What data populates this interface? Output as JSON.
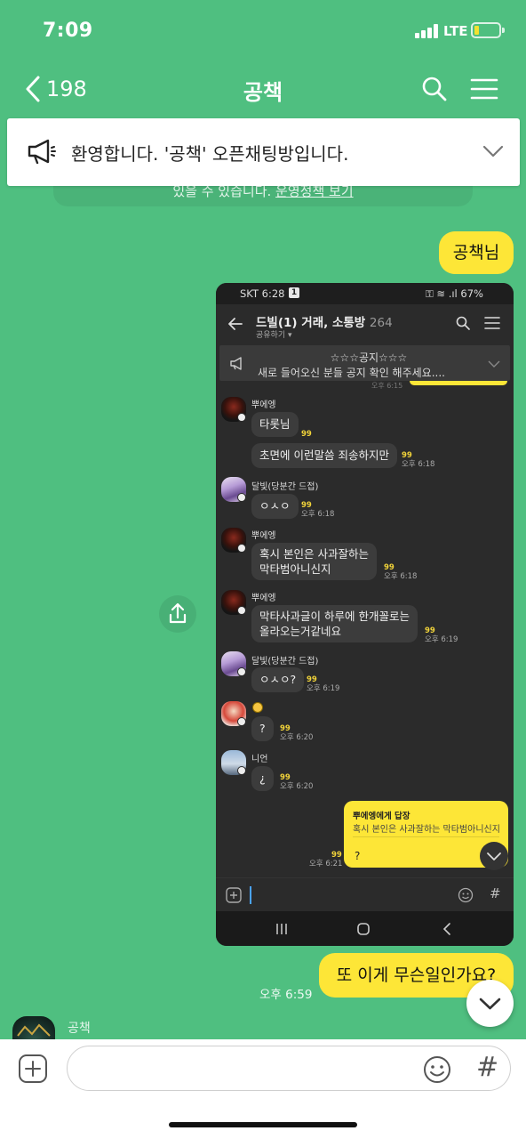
{
  "status_bar": {
    "time": "7:09",
    "network": "LTE"
  },
  "header": {
    "back_count": "198",
    "title": "공책"
  },
  "notice": {
    "text": "환영합니다. '공책' 오픈채팅방입니다.",
    "behind_text": "있을 수 있습니다. ",
    "behind_link": "운영정책 보기"
  },
  "messages": {
    "my_first": "공책님",
    "my_last": "또 이게 무슨일인가요?",
    "my_last_time": "오후 6:59"
  },
  "embedded_screenshot": {
    "status": {
      "carrier_time": "SKT 6:28",
      "badge": "1",
      "battery": "67%"
    },
    "title": "드빌(1) 거래, 소통방",
    "member_count": "264",
    "subtitle": "공유하기 ▾",
    "notice_title": "☆☆☆공지☆☆☆",
    "notice_text": "새로 들어오신 분들 공지 확인 해주세요....",
    "ghost_time": "오후 6:15",
    "messages": [
      {
        "name": "뿌에엥",
        "text1": "타롯님",
        "read1": "99",
        "text2": "초면에 이런말씀 죄송하지만",
        "read2": "99",
        "time": "오후 6:18"
      },
      {
        "name": "달빛(당분간 드접)",
        "text": "ㅇㅅㅇ",
        "read": "99",
        "time": "오후 6:18"
      },
      {
        "name": "뿌에엥",
        "line1": "혹시 본인은 사과잘하는",
        "line2": "막타범아니신지",
        "read": "99",
        "time": "오후 6:18"
      },
      {
        "name": "뿌에엥",
        "line1": "막타사과글이 하루에 한개꼴로는",
        "line2": "올라오는거같네요",
        "read": "99",
        "time": "오후 6:19"
      },
      {
        "name": "달빛(당분간 드접)",
        "text": "ㅇㅅㅇ?",
        "read": "99",
        "time": "오후 6:19"
      },
      {
        "name": "",
        "text": "?",
        "read": "99",
        "time": "오후 6:20"
      },
      {
        "name": "니언",
        "text": "¿",
        "read": "99",
        "time": "오후 6:20"
      }
    ],
    "reply": {
      "header": "뿌에엥에게 답장",
      "quote": "혹시 본인은 사과잘하는 막타범아니신지",
      "text": "?",
      "read": "99",
      "time": "오후 6:21"
    },
    "hash": "#"
  },
  "bottom": {
    "sender_name": "공책",
    "input_value": "",
    "input_placeholder": "",
    "hash": "#"
  },
  "colors": {
    "background": "#4fbf80",
    "my_bubble": "#fde637",
    "embedded_bg": "#2b2b2b"
  }
}
